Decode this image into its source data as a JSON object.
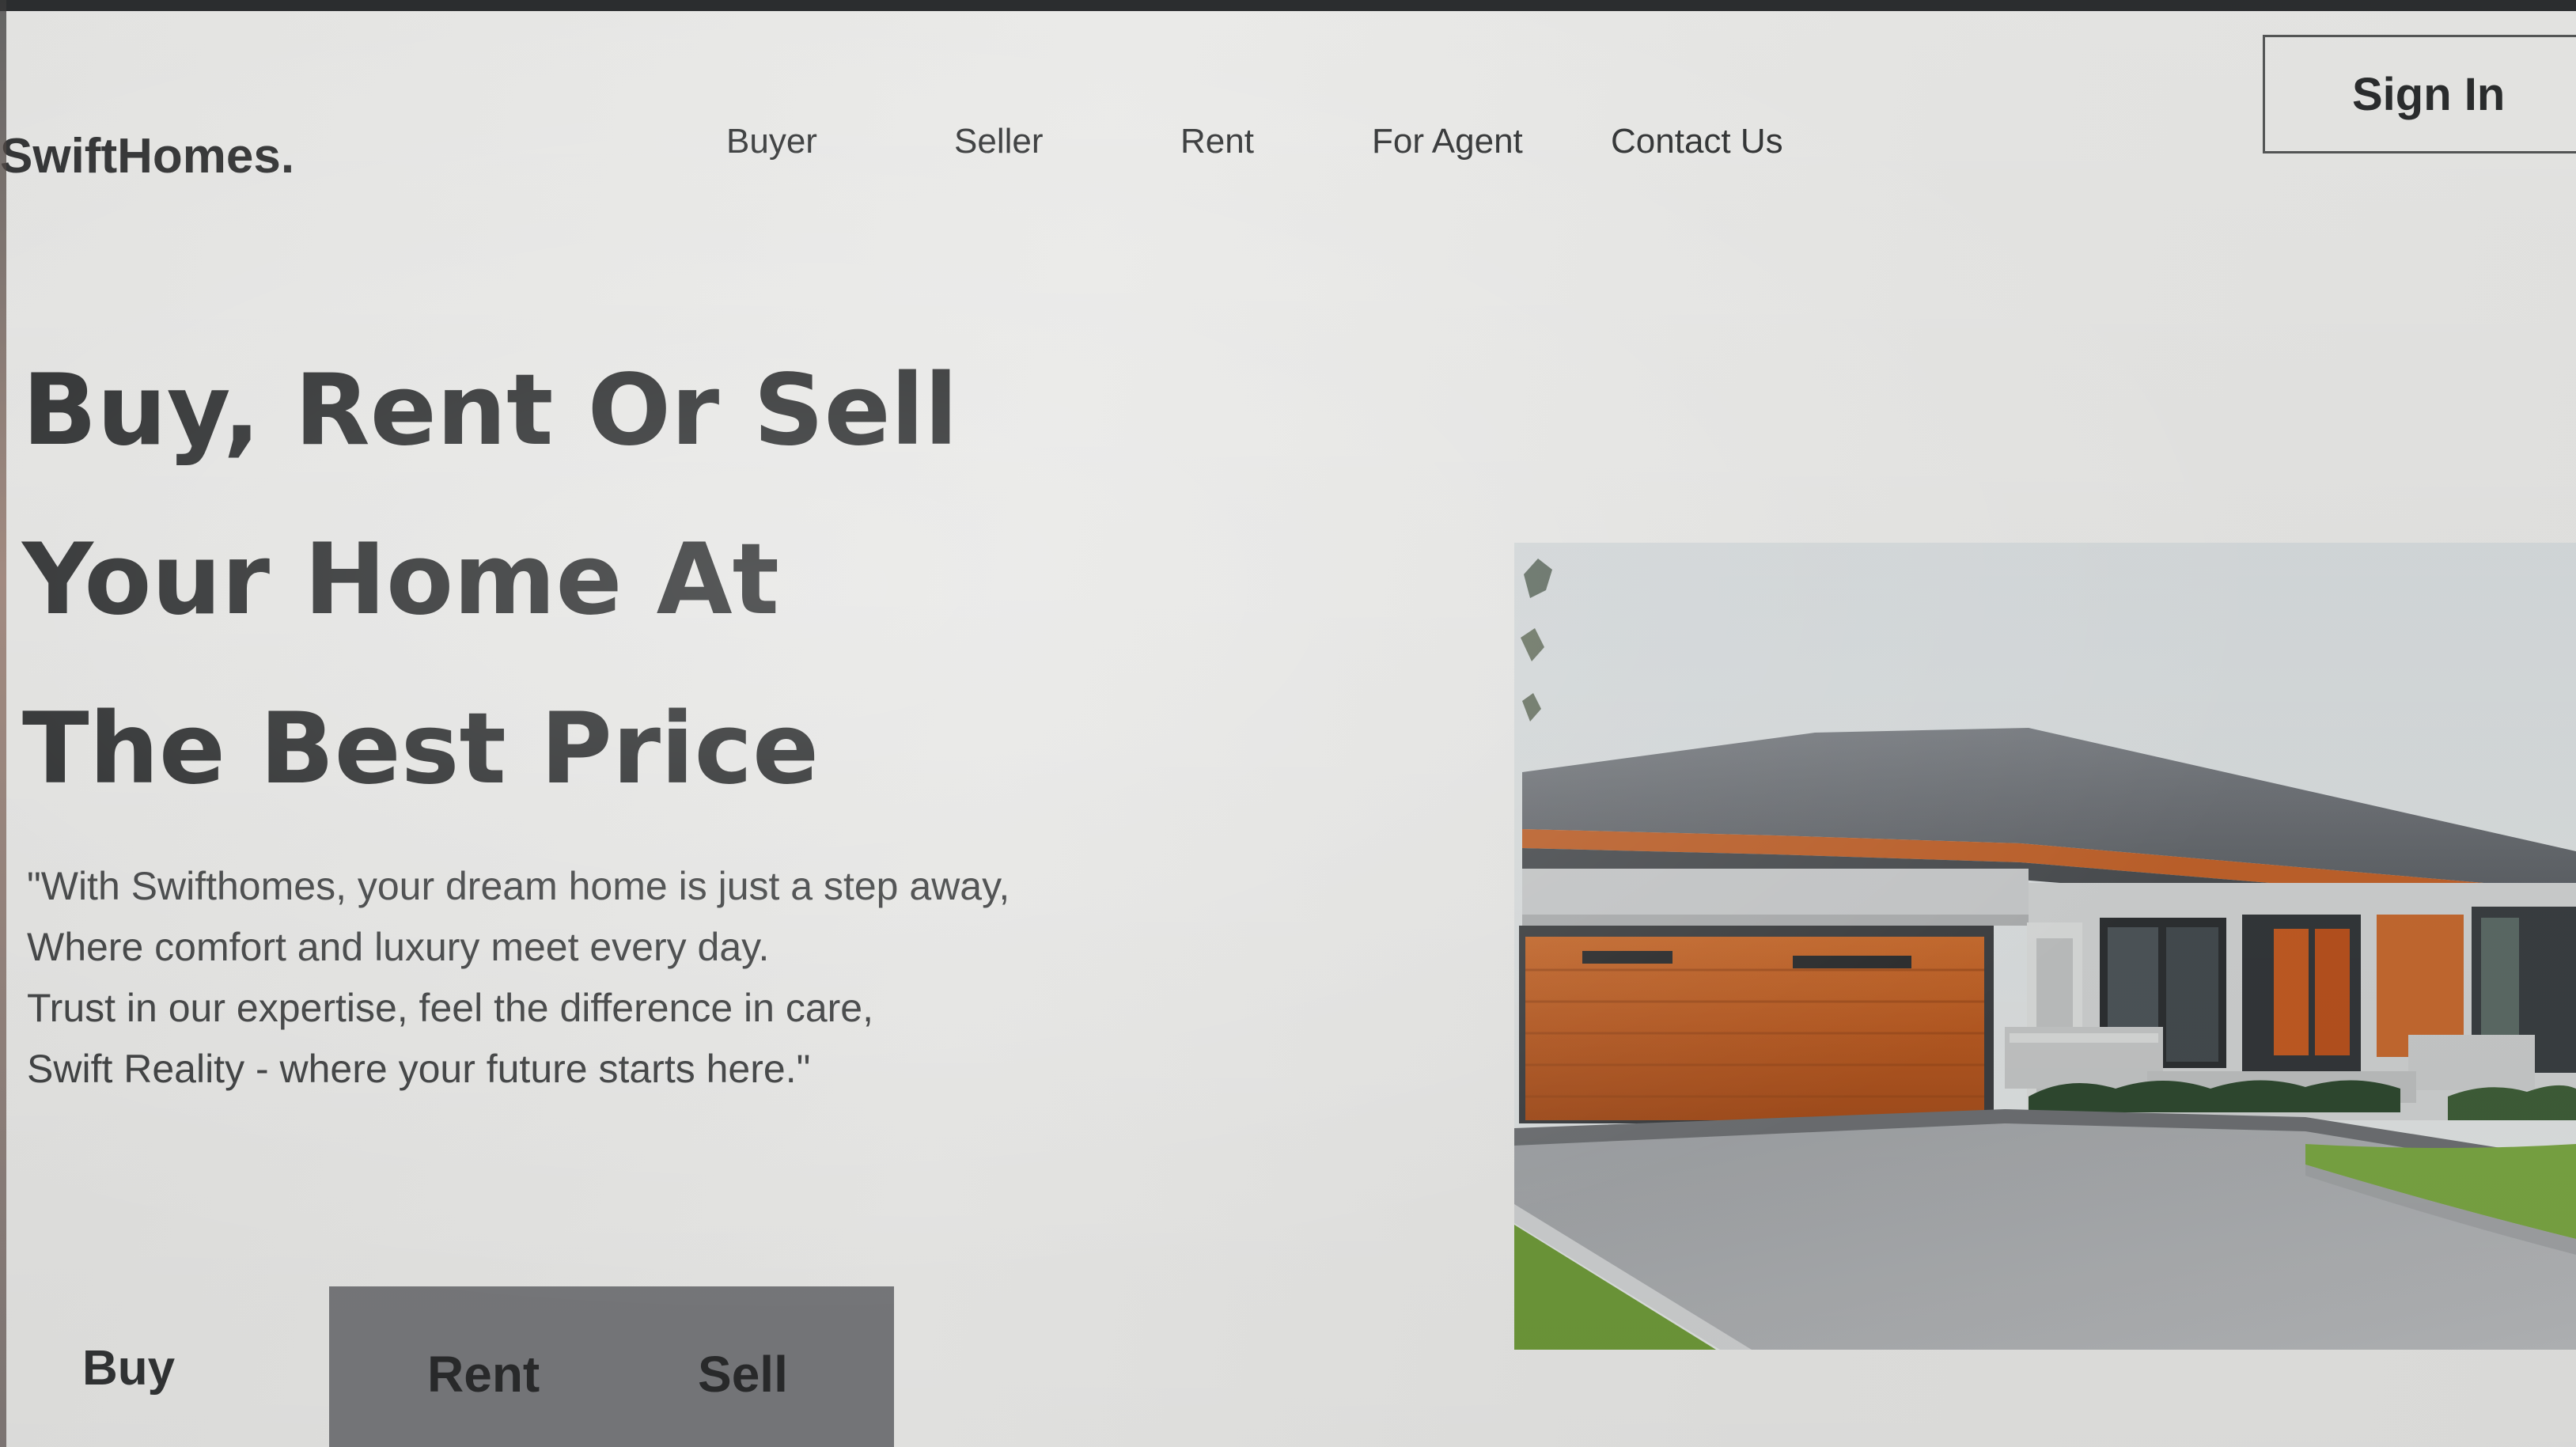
{
  "brand": "SwiftHomes.",
  "nav": {
    "items": [
      "Buyer",
      "Seller",
      "Rent",
      "For Agent",
      "Contact Us"
    ]
  },
  "signin_label": "Sign In",
  "hero": {
    "title_lines": [
      "Buy, Rent Or Sell",
      "Your Home At",
      "The Best Price"
    ],
    "quote_lines": [
      "\"With Swifthomes, your dream home is just a step away,",
      "Where comfort and luxury meet every day.",
      "Trust in our expertise, feel the difference in care,",
      "Swift Reality - where your future starts here.\""
    ]
  },
  "tabs": {
    "buy": "Buy",
    "rent": "Rent",
    "sell": "Sell"
  },
  "colors": {
    "tab_group_bg": "#7a7b7e",
    "text_dark": "#202223",
    "garage_wood": "#c2642a"
  }
}
